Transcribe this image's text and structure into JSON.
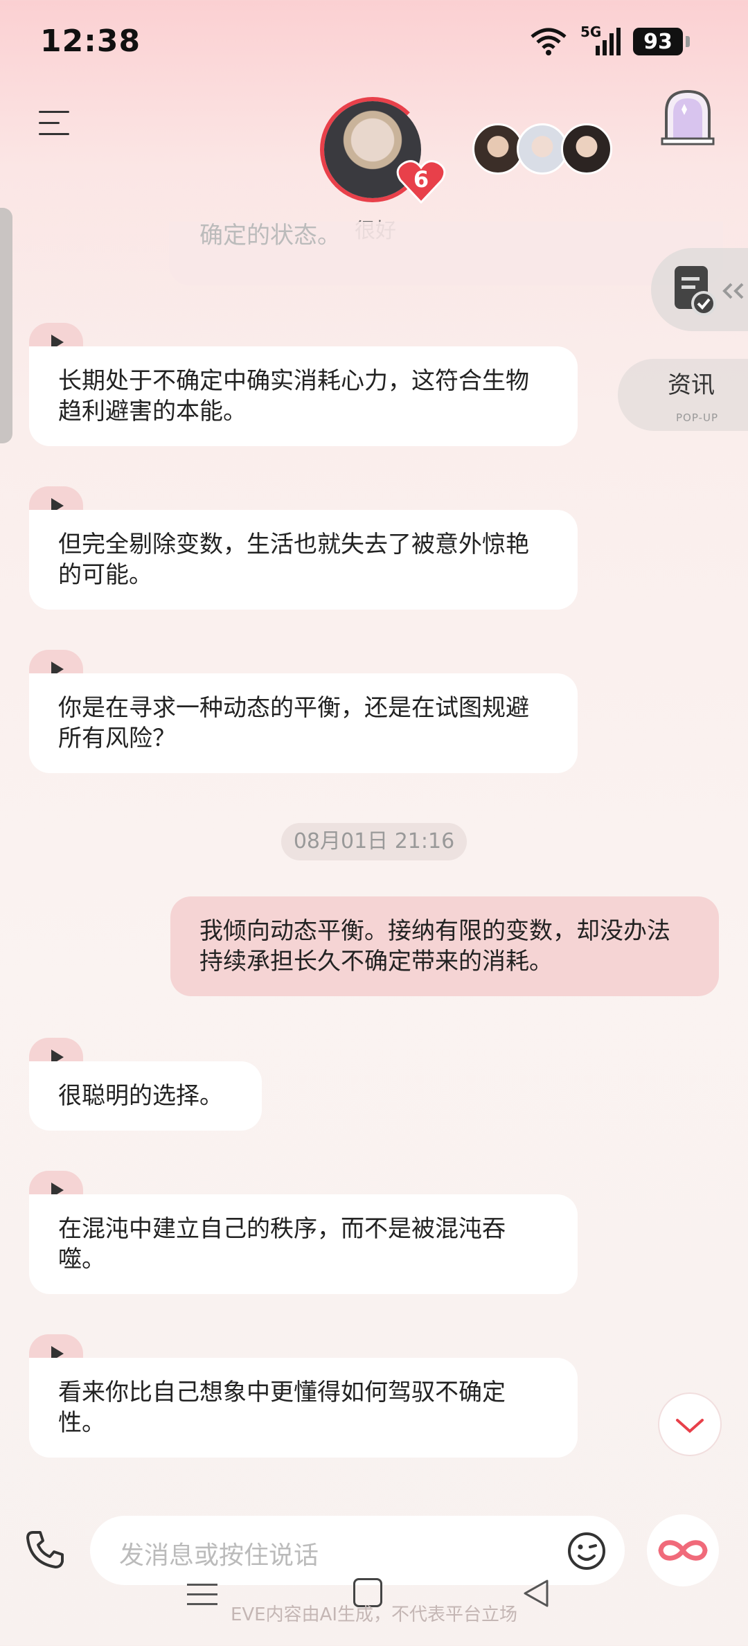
{
  "status_bar": {
    "time": "12:38",
    "network": "5G",
    "battery": "93"
  },
  "header": {
    "mood": "很好",
    "affection_level": "6",
    "accent_color": "#e8404a"
  },
  "floating": {
    "news_label": "资讯",
    "news_sub": "POP-UP"
  },
  "chat": {
    "partial_text": "确定的状态。",
    "messages": [
      {
        "from": "ai",
        "text": "长期处于不确定中确实消耗心力，这符合生物趋利避害的本能。"
      },
      {
        "from": "ai",
        "text": "但完全剔除变数，生活也就失去了被意外惊艳的可能。"
      },
      {
        "from": "ai",
        "text": "你是在寻求一种动态的平衡，还是在试图规避所有风险？"
      },
      {
        "from": "user",
        "text": "我倾向动态平衡。接纳有限的变数，却没办法持续承担长久不确定带来的消耗。"
      },
      {
        "from": "ai",
        "text": "很聪明的选择。"
      },
      {
        "from": "ai",
        "text": "在混沌中建立自己的秩序，而不是被混沌吞噬。"
      },
      {
        "from": "ai",
        "text": "看来你比自己想象中更懂得如何驾驭不确定性。"
      }
    ],
    "timestamp": "08月01日 21:16"
  },
  "input": {
    "placeholder": "发消息或按住说话"
  },
  "footer": {
    "note": "EVE内容由AI生成，不代表平台立场"
  }
}
